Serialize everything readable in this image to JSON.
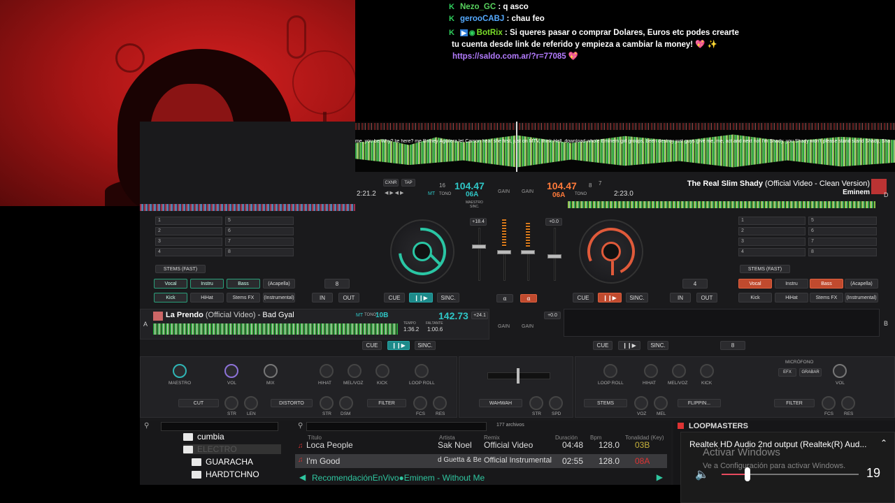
{
  "chat": {
    "messages": [
      {
        "user": "Nezo_GC",
        "text": "q asco"
      },
      {
        "user": "gerooCABJ",
        "text": "chau feo"
      },
      {
        "user": "BotRix",
        "text": "Si queres pasar o comprar Dolares, Euros etc podes crearte tu cuenta desde link de referido y empieza a cambiar la money! 💖 ✨"
      }
    ],
    "link": "https://saldo.com.ar/?r=77085 💖"
  },
  "overview": {
    "lyrics": "me, you be Why? lie here? me Britney Aguilera let Carson hear she first, just on MTV, think Hell, download whole Eminem girl groups, been destroy just guys give me, me, act and next not I'm Shady, you Shady won't please stand stand Shady, Sha"
  },
  "deck_b_top": {
    "time": "2:21.2",
    "btn_cxnr": "CXNR",
    "btn_tap": "TAP",
    "bar": "16",
    "bpm": "104.47",
    "key": "06A",
    "key_label": "MT",
    "tono": "TONO",
    "maestro": "MAESTRO",
    "sinc": "SINC.",
    "pitch": "+18.4"
  },
  "deck_c": {
    "bpm": "104.47",
    "key": "06A",
    "tono": "TONO",
    "bar": "8",
    "loop_count": "7",
    "time": "2:23.0",
    "title": "The Real Slim Shady",
    "subtitle": "(Official Video - Clean Version)",
    "artist": "Eminem",
    "letter": "D",
    "pitch": "+0.0",
    "pitch2": "+0.0"
  },
  "deck_a_track": {
    "title": "La Prendo",
    "subtitle": "(Official Video)",
    "artist": "Bad Gyal",
    "bpm": "142.73",
    "key": "10B",
    "tono": "TONO",
    "tempo_label": "TEMPO",
    "faltante_label": "FALTANTE",
    "elapsed": "1:36.2",
    "remaining": "1:00.6",
    "letter": "A",
    "pitch": "+24.1",
    "pitch2": "+0.0",
    "loop": "8"
  },
  "deck_b_letter": "B",
  "stems": {
    "left": {
      "mode": "STEMS (FAST)",
      "labels": [
        "Vocal",
        "Instru",
        "Bass",
        "(Acapella)",
        "Kick",
        "HiHat",
        "Stems FX",
        "(Instrumental)"
      ],
      "loop": "8"
    },
    "right": {
      "mode": "STEMS (FAST)",
      "labels": [
        "Vocal",
        "Instru",
        "Bass",
        "(Acapella)",
        "Kick",
        "HiHat",
        "Stems FX",
        "(Instrumental)"
      ],
      "loop": "4"
    }
  },
  "hotcues": [
    "1",
    "2",
    "3",
    "4",
    "5",
    "6",
    "7",
    "8"
  ],
  "transport": {
    "cue": "CUE",
    "sinc": "SINC.",
    "in": "IN",
    "out": "OUT"
  },
  "mixer": {
    "gain": "GAIN",
    "maestro": "MAESTRO",
    "vol": "VOL",
    "mix": "MIX",
    "hihat": "HIHAT",
    "melvoz": "MEL/VOZ",
    "kick": "KICK",
    "loop_roll": "LOOP ROLL",
    "microfono": "MICRÓFONO",
    "efx": "EFX",
    "grabar": "GRABAR",
    "fx_left": [
      "CUT",
      "DISTORTO",
      "FILTER",
      "WAHWAH"
    ],
    "fx_right": [
      "STEMS",
      "FLIPPIN...",
      "FILTER"
    ],
    "str": "STR",
    "len": "LEN",
    "dsm": "DSM",
    "fcs": "FCS",
    "res": "RES",
    "spd": "SPD",
    "voz": "VOZ",
    "mel": "MEL"
  },
  "browser": {
    "folders": [
      "cumbia",
      "ELECTRO",
      "GUARACHA",
      "HARDTCHNO"
    ],
    "count": "177 archivos",
    "columns": {
      "title": "Título",
      "artist": "Artista",
      "remix": "Remix",
      "duration": "Duración",
      "bpm": "Bpm",
      "key": "Tonalidad (Key)"
    },
    "tracks": [
      {
        "title": "Loca People",
        "artist": "Sak Noel",
        "remix": "Official Video",
        "duration": "04:48",
        "bpm": "128.0",
        "key": "03B"
      },
      {
        "title": "I'm Good",
        "artist": "d Guetta & Bet",
        "remix": "Official Instrumental",
        "duration": "02:55",
        "bpm": "128.0",
        "key": "08A"
      }
    ],
    "recommendation": "RecomendaciónEnVivo●Eminem - Without Me"
  },
  "sampler": {
    "title": "LOOPMASTERS"
  },
  "volume_popup": {
    "device": "Realtek HD Audio 2nd output (Realtek(R) Aud...",
    "watermark_title": "Activar Windows",
    "watermark_sub": "Ve a Configuración para activar Windows.",
    "level": "19",
    "level_fraction": 0.19
  },
  "colors": {
    "teal": "#2fc6c6",
    "orange": "#ff7a3a",
    "green_wave": "#2aa43a",
    "chat_link": "#b47cff"
  }
}
